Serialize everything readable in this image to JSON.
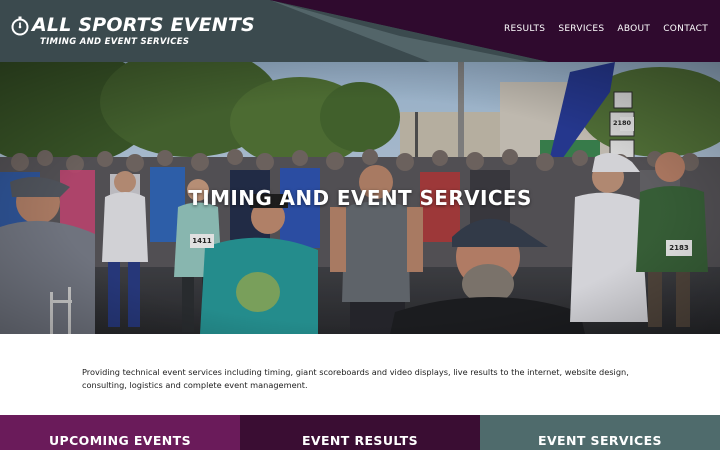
{
  "brand": {
    "title": "ALL SPORTS EVENTS",
    "subtitle": "TIMING AND EVENT SERVICES",
    "logo_icon": "stopwatch-icon"
  },
  "nav": {
    "items": [
      {
        "label": "RESULTS"
      },
      {
        "label": "SERVICES"
      },
      {
        "label": "ABOUT"
      },
      {
        "label": "CONTACT"
      }
    ]
  },
  "hero": {
    "title": "TIMING AND EVENT SERVICES",
    "bibs": [
      "1411",
      "2183",
      "2180"
    ]
  },
  "intro": {
    "text": "Providing technical event services including timing, giant scoreboards and video displays, live results to the internet, website design, consulting, logistics and complete event management."
  },
  "tiles": [
    {
      "label": "UPCOMING EVENTS",
      "color": "#6a1b5a"
    },
    {
      "label": "EVENT RESULTS",
      "color": "#3a0d33"
    },
    {
      "label": "EVENT SERVICES",
      "color": "#4f6b6c"
    }
  ],
  "colors": {
    "header_slate": "#3b4a4e",
    "header_purple": "#2f0a2e",
    "accent_slate": "#57686d"
  }
}
